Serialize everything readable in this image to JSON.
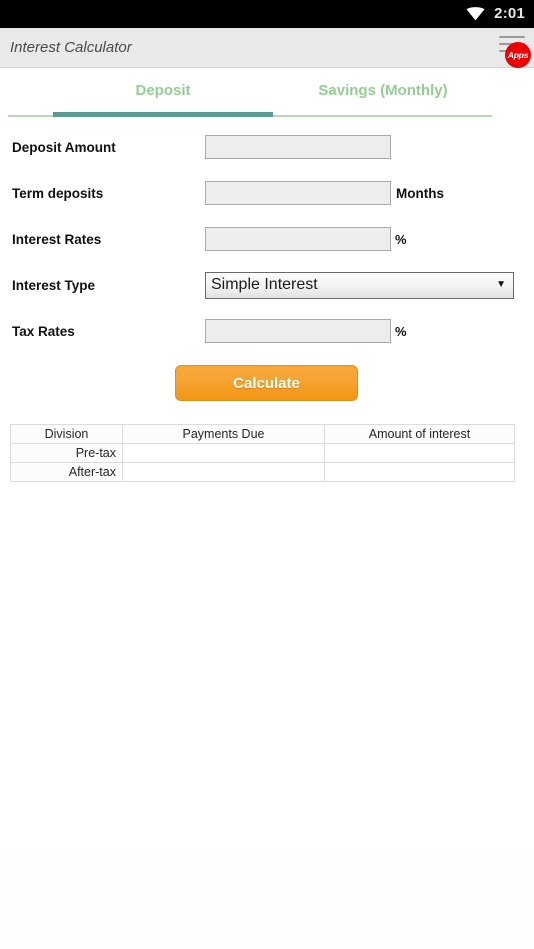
{
  "status_bar": {
    "wifi_icon": "wifi-icon",
    "time": "2:01"
  },
  "app_bar": {
    "title": "Interest Calculator",
    "menu_icon": "hamburger-menu-icon",
    "apps_badge_label": "Apps"
  },
  "tabs": [
    {
      "label": "Deposit",
      "active": true
    },
    {
      "label": "Savings (Monthly)",
      "active": false
    }
  ],
  "form": {
    "rows": [
      {
        "label": "Deposit Amount",
        "value": "",
        "placeholder": "",
        "unit": ""
      },
      {
        "label": "Term deposits",
        "value": "",
        "placeholder": "",
        "unit": "Months"
      },
      {
        "label": "Interest Rates",
        "value": "",
        "placeholder": "",
        "unit": "%"
      },
      {
        "label": "Interest Type",
        "value": "Simple Interest",
        "placeholder": "",
        "unit": ""
      },
      {
        "label": "Tax Rates",
        "value": "",
        "placeholder": "",
        "unit": "%"
      }
    ],
    "interest_type_selected": "Simple Interest",
    "caret_glyph": "▼",
    "calculate_label": "Calculate"
  },
  "results_table": {
    "headers": [
      "Division",
      "Payments Due",
      "Amount of interest"
    ],
    "rows": [
      {
        "division": "Pre-tax",
        "payments_due": "",
        "amount_of_interest": ""
      },
      {
        "division": "After-tax",
        "payments_due": "",
        "amount_of_interest": ""
      }
    ]
  },
  "colors": {
    "status_bar_bg": "#000000",
    "app_bar_bg": "#e9e9e9",
    "tab_text": "#93ce93",
    "tab_active_underline": "#5a9a92",
    "tab_divider": "#b7d9b7",
    "accent_orange": "#f6a330",
    "apps_badge_red": "#ed0000",
    "input_bg": "#ededed",
    "page_bg": "#ffffff"
  }
}
